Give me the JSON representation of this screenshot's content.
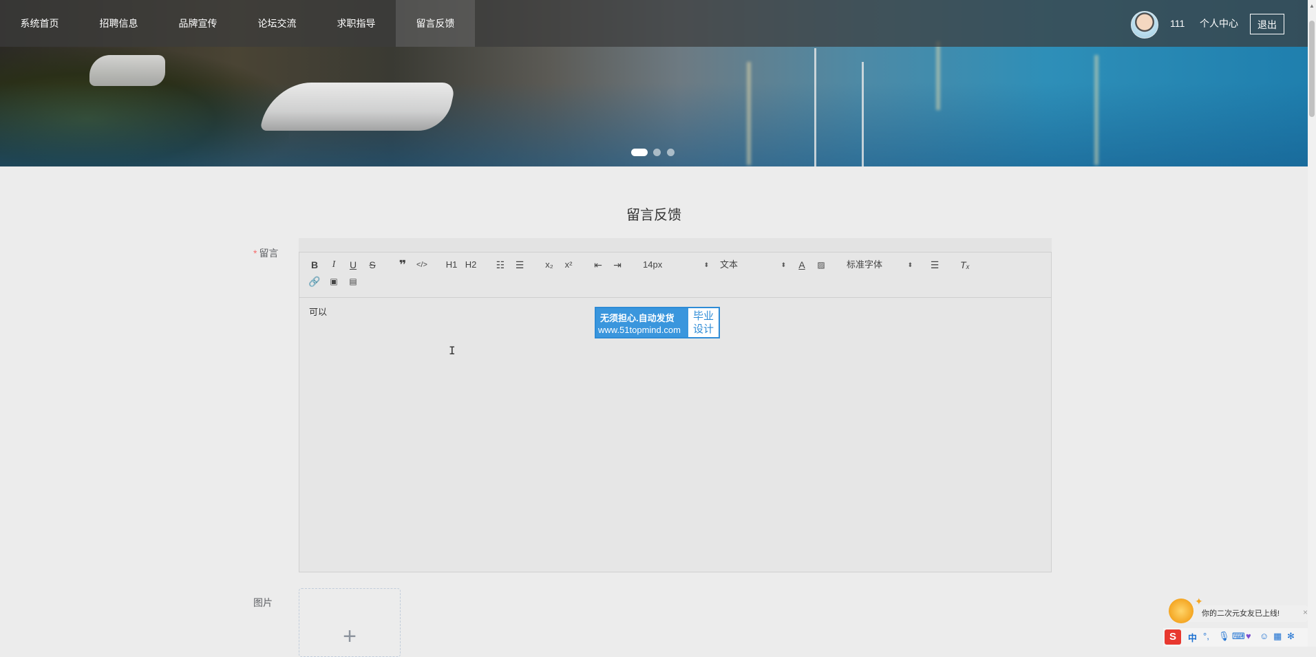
{
  "nav": {
    "items": [
      {
        "label": "系统首页"
      },
      {
        "label": "招聘信息"
      },
      {
        "label": "品牌宣传"
      },
      {
        "label": "论坛交流"
      },
      {
        "label": "求职指导"
      },
      {
        "label": "留言反馈"
      }
    ],
    "active_index": 5,
    "username": "111",
    "center_label": "个人中心",
    "logout_label": "退出"
  },
  "carousel": {
    "slide_count": 3,
    "active_index": 0
  },
  "page": {
    "title": "留言反馈"
  },
  "form": {
    "message": {
      "label": "留言",
      "required_mark": "*",
      "content": "可以"
    },
    "image": {
      "label": "图片",
      "upload_icon": "plus-icon"
    }
  },
  "toolbar": {
    "font_size": "14px",
    "header_select": "文本",
    "font_family": "标准字体",
    "h1": "H1",
    "h2": "H2"
  },
  "watermark": {
    "line1": "无须担心.自动发货",
    "line2": "www.51topmind.com",
    "right1": "毕业",
    "right2": "设计"
  },
  "tray": {
    "message": "你的二次元女友已上线!",
    "ime_label": "S",
    "lang": "中"
  },
  "colors": {
    "nav_bg": "#3c3c3c",
    "accent": "#2d8bd6",
    "required": "#f56c6c",
    "page_bg": "#ececec"
  }
}
